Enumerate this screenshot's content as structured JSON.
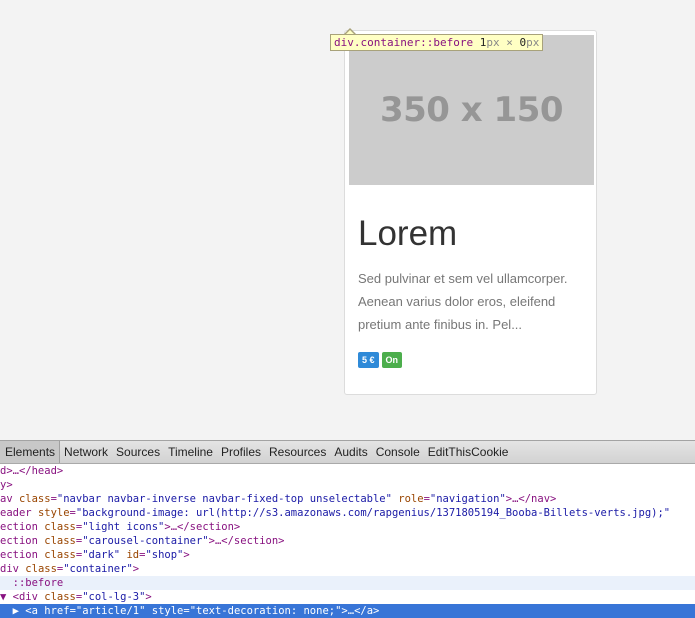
{
  "card": {
    "placeholder_text": "350 x 150",
    "title": "Lorem",
    "text": "Sed pulvinar et sem vel ullamcorper. Aenean varius dolor eros, eleifend pretium ante finibus in. Pel...",
    "badge_price": "5 €",
    "badge_status": "On"
  },
  "tooltip": {
    "selector": "div.container::before",
    "width_num": "1",
    "width_unit": "px",
    "times": " × ",
    "height_num": "0",
    "height_unit": "px"
  },
  "devtools": {
    "tabs": [
      "Elements",
      "Network",
      "Sources",
      "Timeline",
      "Profiles",
      "Resources",
      "Audits",
      "Console",
      "EditThisCookie"
    ],
    "lines": [
      {
        "segs": [
          {
            "c": "t",
            "x": "d>…</head>"
          }
        ]
      },
      {
        "segs": [
          {
            "c": "t",
            "x": "y>"
          }
        ]
      },
      {
        "segs": [
          {
            "c": "t",
            "x": "av "
          },
          {
            "c": "a",
            "x": "class"
          },
          {
            "c": "t",
            "x": "="
          },
          {
            "c": "v",
            "x": "\"navbar navbar-inverse navbar-fixed-top unselectable\""
          },
          {
            "c": "t",
            "x": " "
          },
          {
            "c": "a",
            "x": "role"
          },
          {
            "c": "t",
            "x": "="
          },
          {
            "c": "v",
            "x": "\"navigation\""
          },
          {
            "c": "t",
            "x": ">…</nav>"
          }
        ]
      },
      {
        "segs": [
          {
            "c": "t",
            "x": "eader "
          },
          {
            "c": "a",
            "x": "style"
          },
          {
            "c": "t",
            "x": "="
          },
          {
            "c": "v",
            "x": "\"background-image: url(http://s3.amazonaws.com/rapgenius/1371805194_Booba-Billets-verts.jpg);\""
          }
        ]
      },
      {
        "segs": [
          {
            "c": "t",
            "x": "ection "
          },
          {
            "c": "a",
            "x": "class"
          },
          {
            "c": "t",
            "x": "="
          },
          {
            "c": "v",
            "x": "\"light icons\""
          },
          {
            "c": "t",
            "x": ">…</section>"
          }
        ]
      },
      {
        "segs": [
          {
            "c": "t",
            "x": "ection "
          },
          {
            "c": "a",
            "x": "class"
          },
          {
            "c": "t",
            "x": "="
          },
          {
            "c": "v",
            "x": "\"carousel-container\""
          },
          {
            "c": "t",
            "x": ">…</section>"
          }
        ]
      },
      {
        "segs": [
          {
            "c": "t",
            "x": "ection "
          },
          {
            "c": "a",
            "x": "class"
          },
          {
            "c": "t",
            "x": "="
          },
          {
            "c": "v",
            "x": "\"dark\""
          },
          {
            "c": "t",
            "x": " "
          },
          {
            "c": "a",
            "x": "id"
          },
          {
            "c": "t",
            "x": "="
          },
          {
            "c": "v",
            "x": "\"shop\""
          },
          {
            "c": "t",
            "x": ">"
          }
        ]
      },
      {
        "segs": [
          {
            "c": "t",
            "x": "div "
          },
          {
            "c": "a",
            "x": "class"
          },
          {
            "c": "t",
            "x": "="
          },
          {
            "c": "v",
            "x": "\"container\""
          },
          {
            "c": "t",
            "x": ">"
          }
        ]
      },
      {
        "hl": "light",
        "segs": [
          {
            "c": "t",
            "x": "  ::before"
          }
        ]
      },
      {
        "segs": [
          {
            "c": "t",
            "x": "▼ <div "
          },
          {
            "c": "a",
            "x": "class"
          },
          {
            "c": "t",
            "x": "="
          },
          {
            "c": "v",
            "x": "\"col-lg-3\""
          },
          {
            "c": "t",
            "x": ">"
          }
        ]
      },
      {
        "hl": "sel",
        "segs": [
          {
            "c": "t",
            "x": "  ▶ <a "
          },
          {
            "c": "a",
            "x": "href"
          },
          {
            "c": "t",
            "x": "="
          },
          {
            "c": "v",
            "x": "\"article/1\""
          },
          {
            "c": "t",
            "x": " "
          },
          {
            "c": "a",
            "x": "style"
          },
          {
            "c": "t",
            "x": "="
          },
          {
            "c": "v",
            "x": "\"text-decoration: none;\""
          },
          {
            "c": "t",
            "x": ">…</a>"
          }
        ]
      }
    ]
  }
}
